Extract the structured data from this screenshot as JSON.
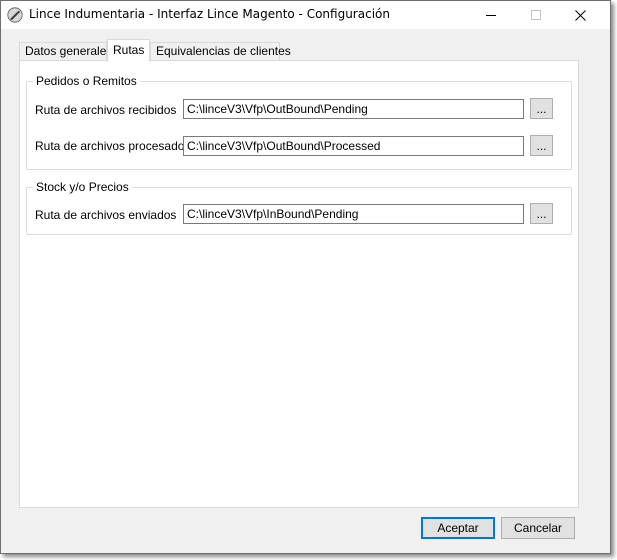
{
  "window": {
    "title": "Lince Indumentaria - Interfaz Lince Magento - Configuración",
    "icon": "lince-app-icon",
    "controls": [
      "minimize-icon",
      "maximize-icon",
      "close-icon"
    ]
  },
  "tabs": [
    {
      "label": "Datos generales",
      "active": false
    },
    {
      "label": "Rutas",
      "active": true
    },
    {
      "label": "Equivalencias de clientes",
      "active": false
    }
  ],
  "groups": {
    "pedidos": {
      "title": "Pedidos o Remitos",
      "fields": [
        {
          "label": "Ruta de archivos recibidos",
          "value": "C:\\linceV3\\Vfp\\OutBound\\Pending",
          "browse_label": "..."
        },
        {
          "label": "Ruta de archivos procesados",
          "value": "C:\\linceV3\\Vfp\\OutBound\\Processed",
          "browse_label": "..."
        }
      ]
    },
    "stock": {
      "title": "Stock y/o Precios",
      "fields": [
        {
          "label": "Ruta de archivos enviados",
          "value": "C:\\linceV3\\Vfp\\InBound\\Pending",
          "browse_label": "..."
        }
      ]
    }
  },
  "buttons": {
    "ok": "Aceptar",
    "cancel": "Cancelar"
  },
  "colors": {
    "accent": "#0078d7",
    "window_bg": "#f0f0f0",
    "panel_bg": "#ffffff"
  }
}
